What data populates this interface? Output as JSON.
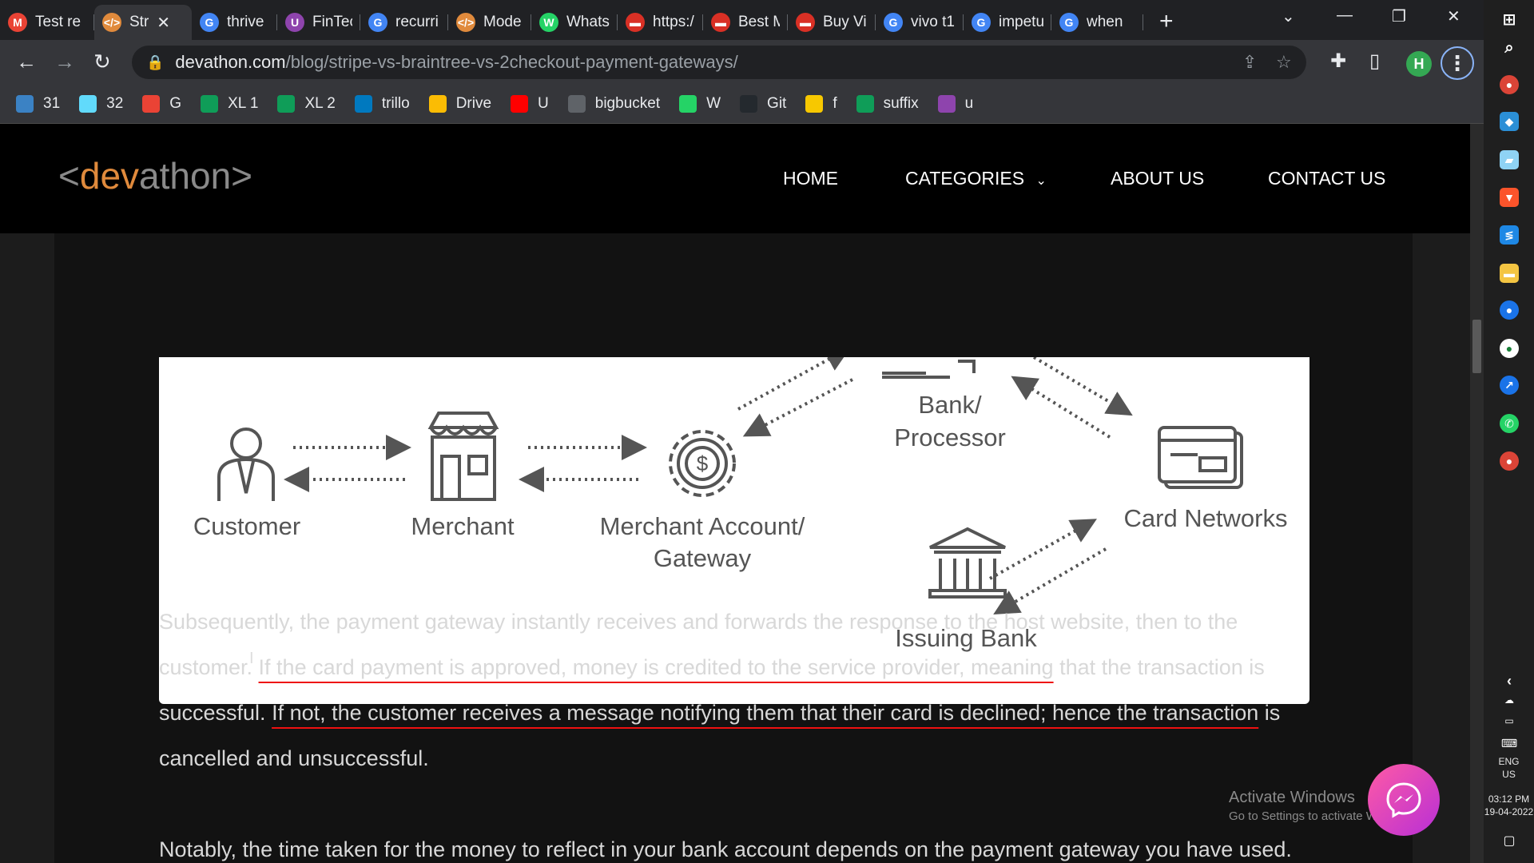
{
  "browser": {
    "tabs": [
      {
        "title": "Test re",
        "icon": "gmail-icon",
        "color": "#ea4335",
        "glyph": "M"
      },
      {
        "title": "Str",
        "icon": "code-icon",
        "color": "#e08a3c",
        "glyph": "</>",
        "active": true
      },
      {
        "title": "thrive",
        "icon": "google-icon",
        "color": "#4285f4",
        "glyph": "G"
      },
      {
        "title": "FinTec",
        "icon": "u-icon",
        "color": "#8e44ad",
        "glyph": "U"
      },
      {
        "title": "recurri",
        "icon": "google-icon",
        "color": "#4285f4",
        "glyph": "G"
      },
      {
        "title": "Mode",
        "icon": "code-icon",
        "color": "#e08a3c",
        "glyph": "</>"
      },
      {
        "title": "Whats",
        "icon": "whatsapp-icon",
        "color": "#25d366",
        "glyph": "W"
      },
      {
        "title": "https:/",
        "icon": "red-bar-icon",
        "color": "#d93025",
        "glyph": "▬"
      },
      {
        "title": "Best M",
        "icon": "red-bar-icon",
        "color": "#d93025",
        "glyph": "▬"
      },
      {
        "title": "Buy Vi",
        "icon": "red-bar-icon",
        "color": "#d93025",
        "glyph": "▬"
      },
      {
        "title": "vivo t1",
        "icon": "google-icon",
        "color": "#4285f4",
        "glyph": "G"
      },
      {
        "title": "impetu",
        "icon": "google-icon",
        "color": "#4285f4",
        "glyph": "G"
      },
      {
        "title": "when",
        "icon": "google-icon",
        "color": "#4285f4",
        "glyph": "G"
      }
    ],
    "close_glyph": "✕",
    "newtab_glyph": "+",
    "url_host": "devathon.com",
    "url_path": "/blog/stripe-vs-braintree-vs-2checkout-payment-gateways/",
    "profile_initial": "H",
    "bookmarks": [
      {
        "label": "31",
        "icon": "bookmark-31-icon",
        "color": "#3b82c4"
      },
      {
        "label": "32",
        "icon": "react-icon",
        "color": "#61dafb"
      },
      {
        "label": "G",
        "icon": "gmail-icon",
        "color": "#ea4335"
      },
      {
        "label": "XL 1",
        "icon": "sheets-icon",
        "color": "#0f9d58"
      },
      {
        "label": "XL 2",
        "icon": "sheets-icon",
        "color": "#0f9d58"
      },
      {
        "label": "trillo",
        "icon": "trello-icon",
        "color": "#0079bf"
      },
      {
        "label": "Drive",
        "icon": "drive-icon",
        "color": "#fbbc04"
      },
      {
        "label": "U",
        "icon": "youtube-icon",
        "color": "#ff0000"
      },
      {
        "label": "bigbucket",
        "icon": "globe-icon",
        "color": "#5f6368"
      },
      {
        "label": "W",
        "icon": "whatsapp-icon",
        "color": "#25d366"
      },
      {
        "label": "Git",
        "icon": "github-icon",
        "color": "#24292e"
      },
      {
        "label": "f",
        "icon": "flipkart-icon",
        "color": "#f7c800"
      },
      {
        "label": "suffix",
        "icon": "sheets-icon",
        "color": "#0f9d58"
      },
      {
        "label": "u",
        "icon": "u-icon",
        "color": "#8e44ad"
      }
    ]
  },
  "site": {
    "logo_open": "<",
    "logo_dev": "dev",
    "logo_athon": "athon",
    "logo_close": ">",
    "nav": {
      "home": "HOME",
      "categories": "CATEGORIES",
      "about": "ABOUT US",
      "contact": "CONTACT US"
    }
  },
  "figure": {
    "labels": {
      "customer": "Customer",
      "merchant": "Merchant",
      "gateway_1": "Merchant Account/",
      "gateway_2": "Gateway",
      "bank_1": "Bank/",
      "bank_2": "Processor",
      "networks": "Card Networks",
      "issuing": "Issuing Bank"
    }
  },
  "article": {
    "p1_a": "Subsequently, the payment gateway instantly receives and forwards the response to the host website, then to the customer. ",
    "p1_u1": "If the card payment is approved, money is credited to the service provider, meaning",
    "p1_b": " that the transaction is successful. ",
    "p1_u2": "If not, the customer receives a message notifying them that their card is declined; hence the transaction",
    "p1_c": " is cancelled and unsuccessful.",
    "p2": "Notably, the time taken for the money to reflect in your bank account depends on the payment gateway you have used."
  },
  "watermark": {
    "line1": "Activate Windows",
    "line2": "Go to Settings to activate Windows."
  },
  "taskbar": {
    "lang_1": "ENG",
    "lang_2": "US",
    "time": "03:12 PM",
    "date": "19-04-2022"
  }
}
